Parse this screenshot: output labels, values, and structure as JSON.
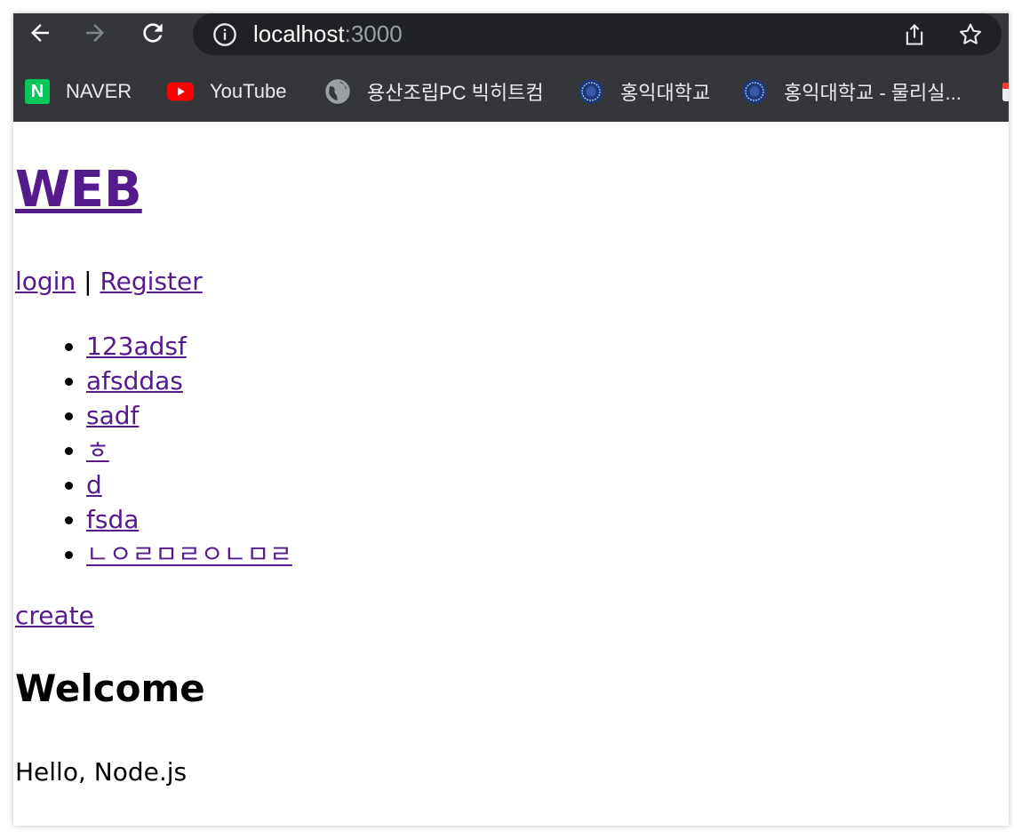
{
  "browser": {
    "address": {
      "host": "localhost",
      "port": ":3000"
    },
    "bookmarks": [
      {
        "label": "NAVER",
        "icon": "naver-icon"
      },
      {
        "label": "YouTube",
        "icon": "youtube-icon"
      },
      {
        "label": "용산조립PC 빅히트컴",
        "icon": "globe-icon"
      },
      {
        "label": "홍익대학교",
        "icon": "hongik-seal-icon"
      },
      {
        "label": "홍익대학교 - 물리실...",
        "icon": "hongik-seal-icon"
      }
    ],
    "colors": {
      "frame": "#35363a",
      "omnibox": "#202124",
      "link": "#551a8b"
    }
  },
  "page": {
    "title": "WEB",
    "auth": {
      "login": "login",
      "separator": "|",
      "register": "Register"
    },
    "topics": [
      "123adsf",
      "afsddas",
      "sadf",
      "ㅎ",
      "d",
      "fsda",
      "ㄴㅇㄹㅁㄹㅇㄴㅁㄹ"
    ],
    "create": "create",
    "heading": "Welcome",
    "body": "Hello, Node.js"
  }
}
